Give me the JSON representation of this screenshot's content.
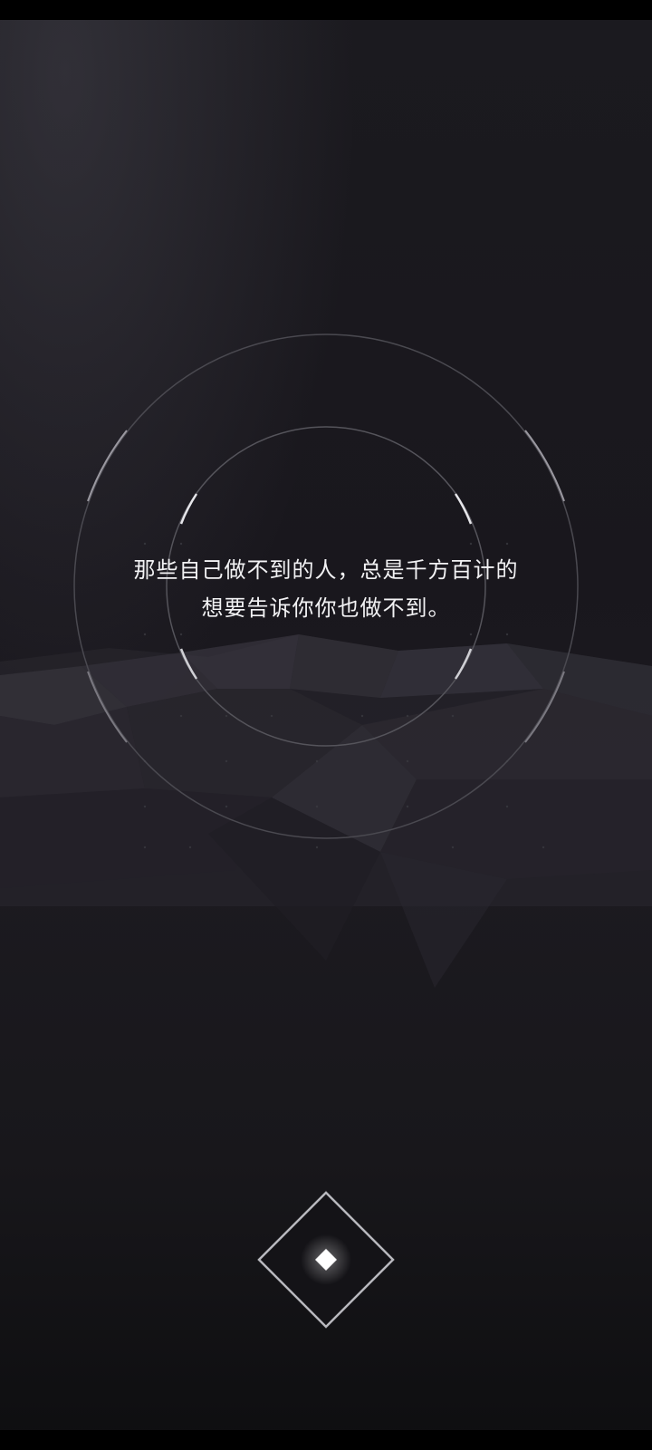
{
  "quote": {
    "line1": "那些自己做不到的人，总是千方百计的",
    "line2": "想要告诉你你也做不到。"
  },
  "start_button": {
    "icon": "diamond-icon"
  },
  "colors": {
    "background": "#1b1a1f",
    "text": "#f2f2f4",
    "ring": "#6a6870",
    "accent": "#ffffff"
  }
}
